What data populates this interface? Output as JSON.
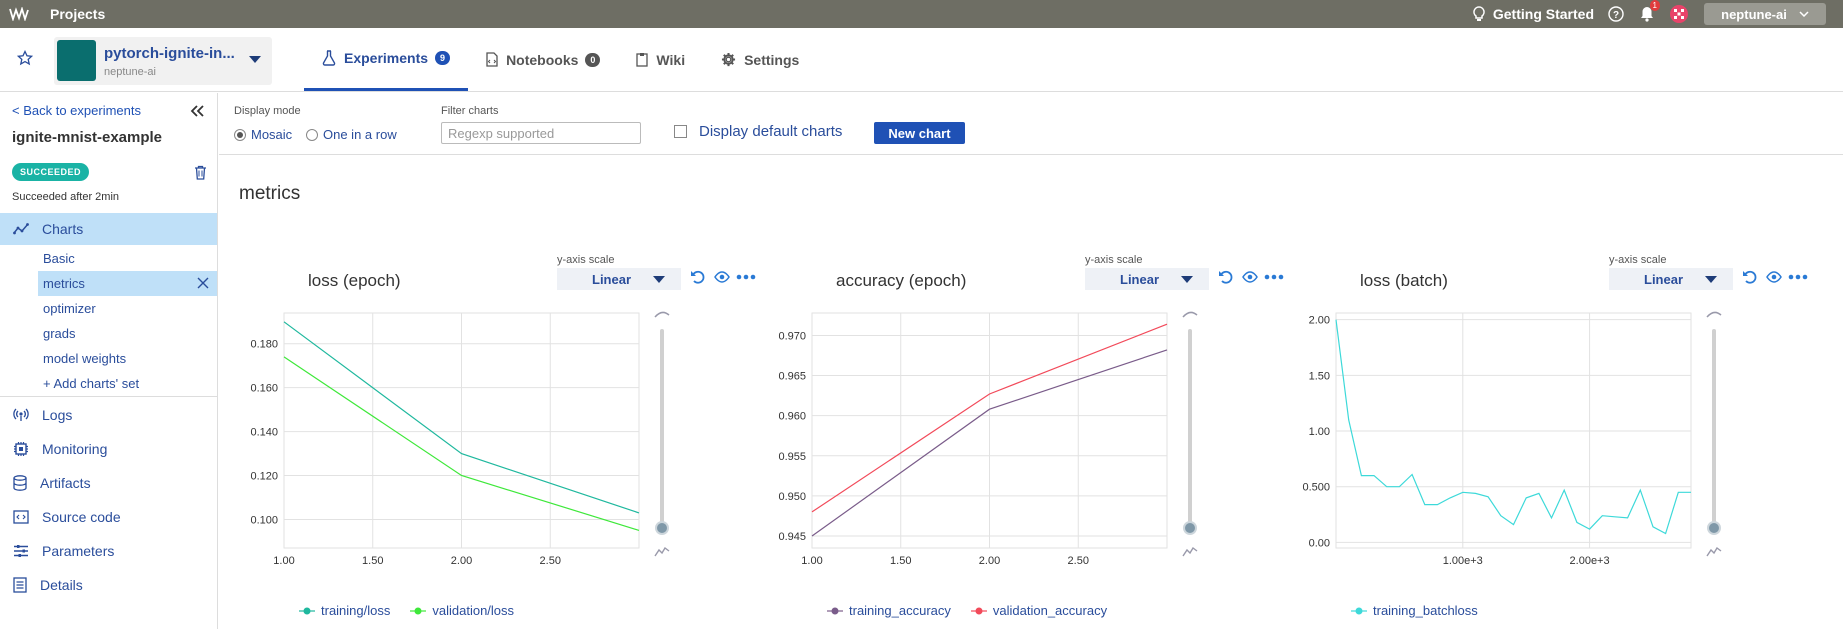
{
  "topbar": {
    "projects_label": "Projects",
    "getting_started": "Getting Started",
    "notifications_count": "1",
    "user": "neptune-ai"
  },
  "project": {
    "name": "pytorch-ignite-in...",
    "org": "neptune-ai"
  },
  "tabs": [
    {
      "label": "Experiments",
      "count": "9"
    },
    {
      "label": "Notebooks",
      "count": "0"
    },
    {
      "label": "Wiki"
    },
    {
      "label": "Settings"
    }
  ],
  "sidebar": {
    "back": "< Back to experiments",
    "experiment_name": "ignite-mnist-example",
    "status": "SUCCEEDED",
    "status_detail": "Succeeded after 2min",
    "charts_label": "Charts",
    "chart_sets": [
      "Basic",
      "metrics",
      "optimizer",
      "grads",
      "model weights",
      "+ Add charts' set"
    ],
    "nav": [
      "Logs",
      "Monitoring",
      "Artifacts",
      "Source code",
      "Parameters",
      "Details"
    ]
  },
  "toolbar": {
    "display_mode_label": "Display mode",
    "mosaic": "Mosaic",
    "one_in_row": "One in a row",
    "filter_label": "Filter charts",
    "filter_placeholder": "Regexp supported",
    "default_charts": "Display default charts",
    "new_chart": "New chart"
  },
  "section_title": "metrics",
  "chart_controls": {
    "yscale_label": "y-axis scale",
    "yscale_value": "Linear"
  },
  "chart_data": [
    {
      "type": "line",
      "title": "loss (epoch)",
      "x_ticks": [
        "1.00",
        "1.50",
        "2.00",
        "2.50"
      ],
      "y_ticks": [
        "0.100",
        "0.120",
        "0.140",
        "0.160",
        "0.180"
      ],
      "xlim": [
        1.0,
        3.0
      ],
      "ylim": [
        0.087,
        0.194
      ],
      "grid": true,
      "series": [
        {
          "name": "training/loss",
          "color": "#1fb89e",
          "x": [
            1,
            2,
            3
          ],
          "y": [
            0.19,
            0.13,
            0.103
          ]
        },
        {
          "name": "validation/loss",
          "color": "#3ee83a",
          "x": [
            1,
            2,
            3
          ],
          "y": [
            0.174,
            0.12,
            0.095
          ]
        }
      ]
    },
    {
      "type": "line",
      "title": "accuracy (epoch)",
      "x_ticks": [
        "1.00",
        "1.50",
        "2.00",
        "2.50"
      ],
      "y_ticks": [
        "0.945",
        "0.950",
        "0.955",
        "0.960",
        "0.965",
        "0.970"
      ],
      "xlim": [
        1.0,
        3.0
      ],
      "ylim": [
        0.9435,
        0.9728
      ],
      "grid": true,
      "series": [
        {
          "name": "training_accuracy",
          "color": "#7a5c8a",
          "x": [
            1,
            2,
            3
          ],
          "y": [
            0.945,
            0.9608,
            0.9682
          ]
        },
        {
          "name": "validation_accuracy",
          "color": "#f24a5a",
          "x": [
            1,
            2,
            3
          ],
          "y": [
            0.948,
            0.9627,
            0.9714
          ]
        }
      ]
    },
    {
      "type": "line",
      "title": "loss (batch)",
      "x_ticks": [
        "1.00e+3",
        "2.00e+3"
      ],
      "y_ticks": [
        "0.00",
        "0.500",
        "1.00",
        "1.50",
        "2.00"
      ],
      "xlim": [
        0,
        2800
      ],
      "ylim": [
        -0.05,
        2.06
      ],
      "grid": true,
      "series": [
        {
          "name": "training_batchloss",
          "color": "#3dd9d9",
          "x": [
            0,
            100,
            200,
            300,
            400,
            500,
            600,
            700,
            800,
            900,
            1000,
            1100,
            1200,
            1300,
            1400,
            1500,
            1600,
            1700,
            1800,
            1900,
            2000,
            2100,
            2200,
            2300,
            2400,
            2500,
            2600,
            2700,
            2800
          ],
          "y": [
            2.0,
            1.1,
            0.6,
            0.6,
            0.5,
            0.5,
            0.61,
            0.34,
            0.34,
            0.4,
            0.45,
            0.44,
            0.41,
            0.24,
            0.16,
            0.4,
            0.44,
            0.22,
            0.47,
            0.18,
            0.12,
            0.24,
            0.23,
            0.22,
            0.47,
            0.14,
            0.08,
            0.45,
            0.45
          ]
        }
      ]
    }
  ]
}
